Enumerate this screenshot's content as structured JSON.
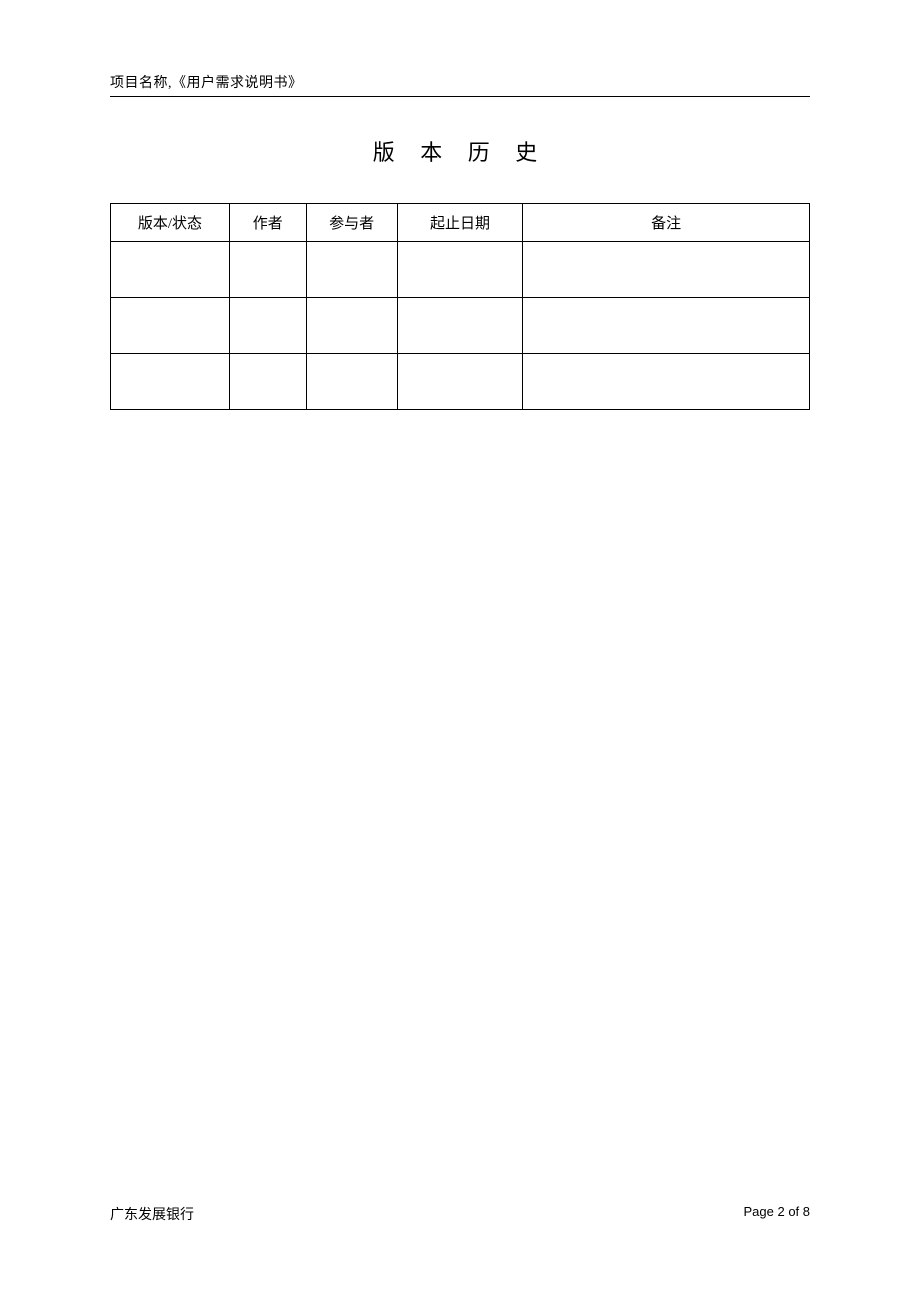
{
  "header": {
    "text": "项目名称,《用户需求说明书》"
  },
  "title": "版 本 历 史",
  "table": {
    "headers": {
      "version": "版本/状态",
      "author": "作者",
      "participant": "参与者",
      "date": "起止日期",
      "remark": "备注"
    },
    "rows": [
      {
        "version": "",
        "author": "",
        "participant": "",
        "date": "",
        "remark": ""
      },
      {
        "version": "",
        "author": "",
        "participant": "",
        "date": "",
        "remark": ""
      },
      {
        "version": "",
        "author": "",
        "participant": "",
        "date": "",
        "remark": ""
      }
    ]
  },
  "footer": {
    "left": "广东发展银行",
    "right": "Page 2 of 8"
  }
}
